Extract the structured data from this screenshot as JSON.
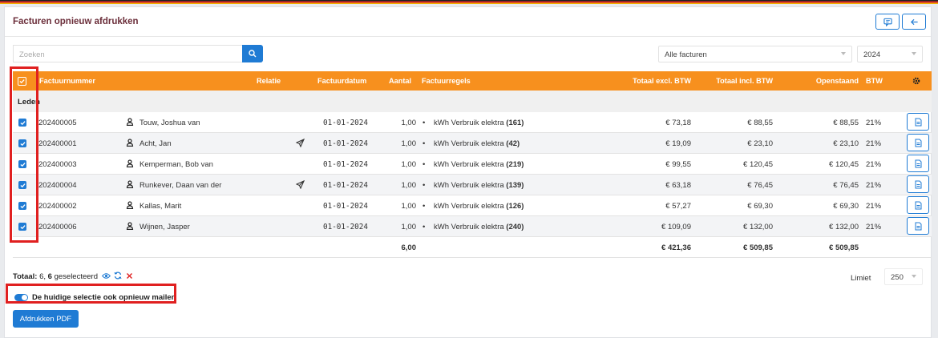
{
  "header": {
    "title": "Facturen opnieuw afdrukken"
  },
  "search": {
    "placeholder": "Zoeken"
  },
  "filter": {
    "invoice_type": "Alle facturen",
    "year": "2024"
  },
  "columns": {
    "invoice_number": "Factuurnummer",
    "relation": "Relatie",
    "invoice_date": "Factuurdatum",
    "quantity": "Aantal",
    "invoice_lines": "Factuurregels",
    "total_excl": "Totaal excl. BTW",
    "total_incl": "Totaal incl. BTW",
    "outstanding": "Openstaand",
    "vat": "BTW"
  },
  "group": {
    "label": "Leden"
  },
  "rows": [
    {
      "number": "202400005",
      "relation": "Touw, Joshua van",
      "sent": false,
      "date": "01-01-2024",
      "qty": "1,00",
      "line_text": "kWh Verbruik elektra",
      "line_qty": "(161)",
      "excl": "€ 73,18",
      "incl": "€ 88,55",
      "open": "€ 88,55",
      "vat": "21%"
    },
    {
      "number": "202400001",
      "relation": "Acht, Jan",
      "sent": true,
      "date": "01-01-2024",
      "qty": "1,00",
      "line_text": "kWh Verbruik elektra",
      "line_qty": "(42)",
      "excl": "€ 19,09",
      "incl": "€ 23,10",
      "open": "€ 23,10",
      "vat": "21%"
    },
    {
      "number": "202400003",
      "relation": "Kemperman, Bob van",
      "sent": false,
      "date": "01-01-2024",
      "qty": "1,00",
      "line_text": "kWh Verbruik elektra",
      "line_qty": "(219)",
      "excl": "€ 99,55",
      "incl": "€ 120,45",
      "open": "€ 120,45",
      "vat": "21%"
    },
    {
      "number": "202400004",
      "relation": "Runkever, Daan van der",
      "sent": true,
      "date": "01-01-2024",
      "qty": "1,00",
      "line_text": "kWh Verbruik elektra",
      "line_qty": "(139)",
      "excl": "€ 63,18",
      "incl": "€ 76,45",
      "open": "€ 76,45",
      "vat": "21%"
    },
    {
      "number": "202400002",
      "relation": "Kallas, Marit",
      "sent": false,
      "date": "01-01-2024",
      "qty": "1,00",
      "line_text": "kWh Verbruik elektra",
      "line_qty": "(126)",
      "excl": "€ 57,27",
      "incl": "€ 69,30",
      "open": "€ 69,30",
      "vat": "21%"
    },
    {
      "number": "202400006",
      "relation": "Wijnen, Jasper",
      "sent": false,
      "date": "01-01-2024",
      "qty": "1,00",
      "line_text": "kWh Verbruik elektra",
      "line_qty": "(240)",
      "excl": "€ 109,09",
      "incl": "€ 132,00",
      "open": "€ 132,00",
      "vat": "21%"
    }
  ],
  "totals": {
    "qty": "6,00",
    "excl": "€ 421,36",
    "incl": "€ 509,85",
    "open": "€ 509,85"
  },
  "footer": {
    "total_label": "Totaal:",
    "total_count": "6,",
    "selected_count": "6",
    "selected_label": "geselecteerd",
    "limit_label": "Limiet",
    "limit_value": "250",
    "mail_toggle_label": "De huidige selectie ook opnieuw mailen",
    "print_button": "Afdrukken PDF"
  },
  "colors": {
    "accent": "#1f7bd4",
    "header_orange": "#f7901e",
    "title": "#6b2e3a",
    "highlight": "#e02020"
  }
}
